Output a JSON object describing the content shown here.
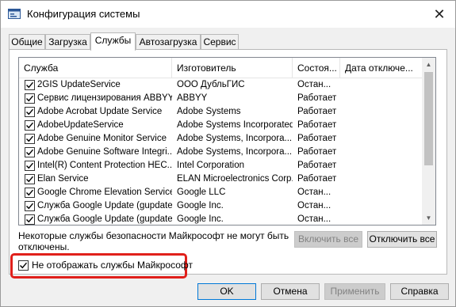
{
  "window": {
    "title": "Конфигурация системы",
    "close_glyph": "✕"
  },
  "tabs": [
    {
      "label": "Общие"
    },
    {
      "label": "Загрузка"
    },
    {
      "label": "Службы"
    },
    {
      "label": "Автозагрузка"
    },
    {
      "label": "Сервис"
    }
  ],
  "active_tab": "Службы",
  "columns": [
    "Служба",
    "Изготовитель",
    "Состоя...",
    "Дата отключе..."
  ],
  "services": [
    {
      "checked": true,
      "name": "2GIS UpdateService",
      "maker": "ООО ДубльГИС",
      "status": "Остан...",
      "date": ""
    },
    {
      "checked": true,
      "name": "Сервис лицензирования ABBYY...",
      "maker": "ABBYY",
      "status": "Работает",
      "date": ""
    },
    {
      "checked": true,
      "name": "Adobe Acrobat Update Service",
      "maker": "Adobe Systems",
      "status": "Работает",
      "date": ""
    },
    {
      "checked": true,
      "name": "AdobeUpdateService",
      "maker": "Adobe Systems Incorporated",
      "status": "Работает",
      "date": ""
    },
    {
      "checked": true,
      "name": "Adobe Genuine Monitor Service",
      "maker": "Adobe Systems, Incorpora...",
      "status": "Работает",
      "date": ""
    },
    {
      "checked": true,
      "name": "Adobe Genuine Software Integri...",
      "maker": "Adobe Systems, Incorpora...",
      "status": "Работает",
      "date": ""
    },
    {
      "checked": true,
      "name": "Intel(R) Content Protection HEC...",
      "maker": "Intel Corporation",
      "status": "Работает",
      "date": ""
    },
    {
      "checked": true,
      "name": "Elan Service",
      "maker": "ELAN Microelectronics Corp.",
      "status": "Работает",
      "date": ""
    },
    {
      "checked": true,
      "name": "Google Chrome Elevation Service",
      "maker": "Google LLC",
      "status": "Остан...",
      "date": ""
    },
    {
      "checked": true,
      "name": "Служба Google Update (gupdate)",
      "maker": "Google Inc.",
      "status": "Остан...",
      "date": ""
    },
    {
      "checked": true,
      "name": "Служба Google Update (gupdatem)",
      "maker": "Google Inc.",
      "status": "Остан...",
      "date": ""
    }
  ],
  "note": "Некоторые службы безопасности Майкрософт не могут быть отключены.",
  "enable_all_label": "Включить все",
  "disable_all_label": "Отключить все",
  "hide_ms": {
    "label": "Не отображать службы Майкрософт",
    "checked": true,
    "highlight_color": "#e0201b"
  },
  "buttons": {
    "ok": "OK",
    "cancel": "Отмена",
    "apply": "Применить",
    "help": "Справка"
  },
  "colors": {
    "accent": "#0078d7",
    "highlight": "#e0201b"
  }
}
